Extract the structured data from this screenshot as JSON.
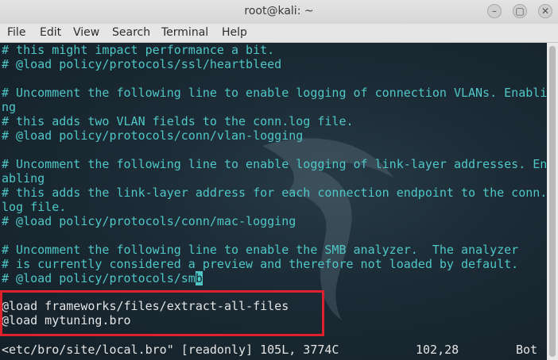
{
  "window": {
    "title": "root@kali: ~",
    "minimize_glyph": "–",
    "maximize_glyph": "▢",
    "close_glyph": "✕"
  },
  "menu": [
    "File",
    "Edit",
    "View",
    "Search",
    "Terminal",
    "Help"
  ],
  "terminal": {
    "lines": [
      "# this might impact performance a bit.",
      "# @load policy/protocols/ssl/heartbleed",
      "",
      "# Uncomment the following line to enable logging of connection VLANs. Enabli",
      "ng",
      "# this adds two VLAN fields to the conn.log file.",
      "# @load policy/protocols/conn/vlan-logging",
      "",
      "# Uncomment the following line to enable logging of link-layer addresses. En",
      "abling",
      "# this adds the link-layer address for each connection endpoint to the conn.",
      "log file.",
      "# @load policy/protocols/conn/mac-logging",
      "",
      "# Uncomment the following line to enable the SMB analyzer.  The analyzer",
      "# is currently considered a preview and therefore not loaded by default.",
      "# @load policy/protocols/sm"
    ],
    "cursor_char": "b",
    "loads": [
      "@load frameworks/files/extract-all-files",
      "@load mytuning.bro"
    ],
    "tilde": "~",
    "status_file": "<etc/bro/site/local.bro\" [readonly] 105L, 3774C",
    "status_pos": "102,28",
    "status_scroll": "Bot"
  },
  "colors": {
    "comment": "#4fc7c7",
    "text": "#e4e4e4",
    "highlight_box": "#e0202a"
  }
}
